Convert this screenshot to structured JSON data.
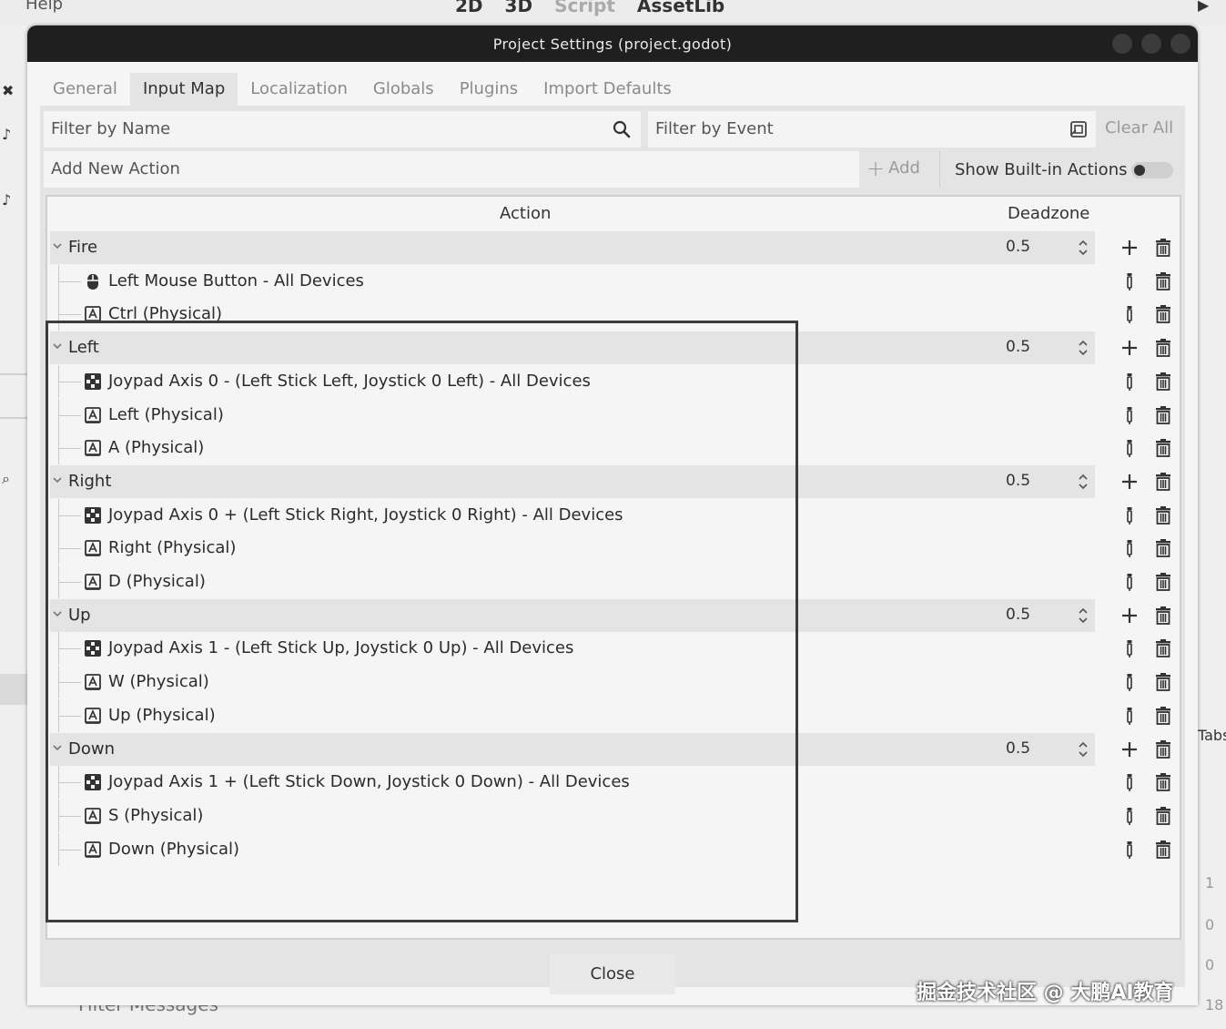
{
  "editor": {
    "menu_help": "Help",
    "modes": [
      "2D",
      "3D",
      "Script",
      "AssetLib"
    ],
    "filter_messages": "Filter Messages",
    "right_tabs": "Tabs",
    "right_numbers": [
      "1",
      "0",
      "0",
      "18"
    ]
  },
  "dialog": {
    "title": "Project Settings (project.godot)",
    "tabs": [
      "General",
      "Input Map",
      "Localization",
      "Globals",
      "Plugins",
      "Import Defaults"
    ],
    "active_tab": "Input Map",
    "filter_name_placeholder": "Filter by Name",
    "filter_event_placeholder": "Filter by Event",
    "clear_all": "Clear All",
    "add_new_action_placeholder": "Add New Action",
    "add_button": "Add",
    "show_builtin": "Show Built-in Actions",
    "show_builtin_on": false,
    "col_action": "Action",
    "col_deadzone": "Deadzone",
    "close": "Close"
  },
  "actions": [
    {
      "name": "Fire",
      "deadzone": "0.5",
      "events": [
        {
          "icon": "mouse-icon",
          "label": "Left Mouse Button - All Devices"
        },
        {
          "icon": "keyboard-icon",
          "label": "Ctrl (Physical)"
        }
      ]
    },
    {
      "name": "Left",
      "deadzone": "0.5",
      "events": [
        {
          "icon": "joypad-icon",
          "label": "Joypad Axis 0 - (Left Stick Left, Joystick 0 Left) - All Devices"
        },
        {
          "icon": "keyboard-icon",
          "label": "Left (Physical)"
        },
        {
          "icon": "keyboard-icon",
          "label": "A (Physical)"
        }
      ]
    },
    {
      "name": "Right",
      "deadzone": "0.5",
      "events": [
        {
          "icon": "joypad-icon",
          "label": "Joypad Axis 0 + (Left Stick Right, Joystick 0 Right) - All Devices"
        },
        {
          "icon": "keyboard-icon",
          "label": "Right (Physical)"
        },
        {
          "icon": "keyboard-icon",
          "label": "D (Physical)"
        }
      ]
    },
    {
      "name": "Up",
      "deadzone": "0.5",
      "events": [
        {
          "icon": "joypad-icon",
          "label": "Joypad Axis 1 - (Left Stick Up, Joystick 0 Up) - All Devices"
        },
        {
          "icon": "keyboard-icon",
          "label": "W (Physical)"
        },
        {
          "icon": "keyboard-icon",
          "label": "Up (Physical)"
        }
      ]
    },
    {
      "name": "Down",
      "deadzone": "0.5",
      "events": [
        {
          "icon": "joypad-icon",
          "label": "Joypad Axis 1 + (Left Stick Down, Joystick 0 Down) - All Devices"
        },
        {
          "icon": "keyboard-icon",
          "label": "S (Physical)"
        },
        {
          "icon": "keyboard-icon",
          "label": "Down (Physical)"
        }
      ]
    }
  ],
  "watermark": "掘金技术社区 @ 大鹏AI教育"
}
